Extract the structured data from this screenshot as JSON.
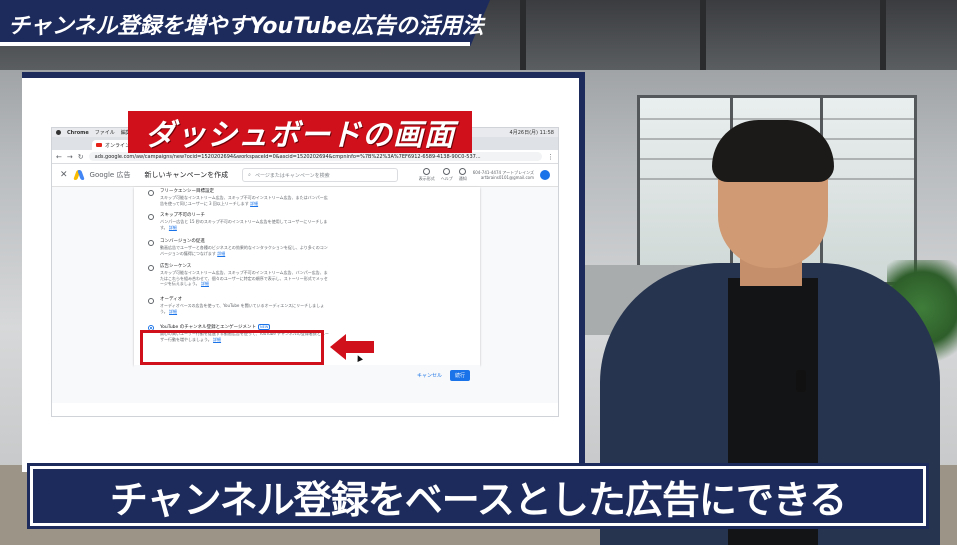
{
  "video": {
    "top_title": "チャンネル登録を増やすYouTube広告の活用法",
    "highlight_label": "ダッシュボードの画面",
    "caption": "チャンネル登録をベースとした広告にできる"
  },
  "browser": {
    "menubar": {
      "app": "Chrome",
      "file": "ファイル",
      "edit": "編集",
      "datetime": "4月26日(月) 11:58"
    },
    "tab_title": "オンラインのディ",
    "url": "ads.google.com/aw/campaigns/new?ocid=1520202694&workspaceId=0&ascid=1520202694&cmpninfo=%7B%22%3A%7EF6912-6589-4138-90C0-537..."
  },
  "ads_header": {
    "product": "Google 広告",
    "page_title": "新しいキャンペーンを作成",
    "search_placeholder": "ページまたはキャンペーンを検索",
    "icons": [
      {
        "name": "report-icon",
        "label": "表示形式"
      },
      {
        "name": "help-icon",
        "label": "ヘルプ"
      },
      {
        "name": "notification-icon",
        "label": "通知"
      }
    ],
    "account_id": "604-741-4474 アートブレインズ",
    "account_email": "artbrains0101@gmail.com"
  },
  "campaign_options": [
    {
      "title": "フリークエンシー目標設定",
      "desc": "スキップ可能なインストリーム広告、スキップ不可のインストリーム広告、またはバンパー広告を使って同じユーザーに 3 回以上リーチします",
      "more": "詳細",
      "selected": false
    },
    {
      "title": "スキップ不可のリーチ",
      "desc": "バンパー広告と 15 秒のスキップ不可のインストリーム広告を使用してユーザーにリーチします。",
      "more": "詳細",
      "selected": false
    },
    {
      "title": "コンバージョンの促進",
      "desc": "動画広告でユーザーと各種のビジネスとの効果的なインタラクションを促し、より多くのコンバージョンの獲得につなげます",
      "more": "詳細",
      "selected": false
    },
    {
      "title": "広告シーケンス",
      "desc": "スキップ可能なインストリーム広告、スキップ不可のインストリーム広告、バンパー広告、またはこれらを組み合わせて、個々のユーザーに特定の順序で表示し、ストーリー形式でメッセージを伝えましょう。",
      "more": "詳細",
      "selected": false
    },
    {
      "title": "オーディオ",
      "desc": "オーディオベースの広告を使って、YouTube を聞いているオーディエンスにリーチしましょう。",
      "more": "詳細",
      "selected": false
    },
    {
      "title": "YouTube のチャンネル登録とエンゲージメント",
      "badge": "NEW",
      "desc": "関心の高いユーザー行動を促進する動画広告を使って、YouTube チャンネルの登録者数とユーザー行動を増やしましょう。",
      "more": "詳細",
      "selected": true
    }
  ],
  "actions": {
    "cancel": "キャンセル",
    "next": "続行"
  }
}
